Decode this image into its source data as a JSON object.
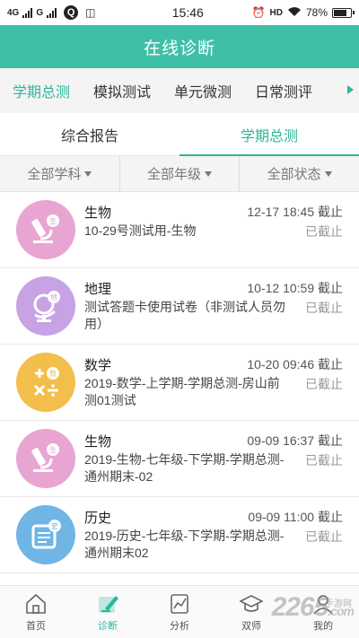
{
  "status_bar": {
    "net_left": "4G",
    "net_mid": "G",
    "time": "15:46",
    "hd": "HD",
    "battery": "78%",
    "battery_level": 0.78
  },
  "header": {
    "title": "在线诊断"
  },
  "category_tabs": [
    {
      "label": "学期总测",
      "active": true
    },
    {
      "label": "模拟测试",
      "active": false
    },
    {
      "label": "单元微测",
      "active": false
    },
    {
      "label": "日常测评",
      "active": false
    }
  ],
  "sub_tabs": [
    {
      "label": "综合报告",
      "active": false
    },
    {
      "label": "学期总测",
      "active": true
    }
  ],
  "filters": [
    {
      "label": "全部学科"
    },
    {
      "label": "全部年级"
    },
    {
      "label": "全部状态"
    }
  ],
  "items": [
    {
      "subject": "生物",
      "title": "10-29号测试用-生物",
      "deadline": "12-17 18:45 截止",
      "status": "已截止",
      "icon": "microscope-icon",
      "color": "#e8a5d2",
      "badge": "生"
    },
    {
      "subject": "地理",
      "title": "测试答题卡使用试卷（非测试人员勿用）",
      "deadline": "10-12 10:59 截止",
      "status": "已截止",
      "icon": "globe-icon",
      "color": "#c7a2e4",
      "badge": "地"
    },
    {
      "subject": "数学",
      "title": "2019-数学-上学期-学期总测-房山前测01测试",
      "deadline": "10-20 09:46 截止",
      "status": "已截止",
      "icon": "math-symbols-icon",
      "color": "#f2be4c",
      "badge": "数"
    },
    {
      "subject": "生物",
      "title": "2019-生物-七年级-下学期-学期总测-通州期末-02",
      "deadline": "09-09 16:37 截止",
      "status": "已截止",
      "icon": "microscope-icon",
      "color": "#e8a5d2",
      "badge": "生"
    },
    {
      "subject": "历史",
      "title": "2019-历史-七年级-下学期-学期总测-通州期末02",
      "deadline": "09-09 11:00 截止",
      "status": "已截止",
      "icon": "scroll-icon",
      "color": "#6fb5e6",
      "badge": "史"
    }
  ],
  "bottom_nav": [
    {
      "label": "首页",
      "icon": "home-icon",
      "active": false
    },
    {
      "label": "诊断",
      "icon": "pencil-icon",
      "active": true
    },
    {
      "label": "分析",
      "icon": "chart-icon",
      "active": false
    },
    {
      "label": "双师",
      "icon": "graduation-cap-icon",
      "active": false
    },
    {
      "label": "我的",
      "icon": "user-icon",
      "active": false
    }
  ],
  "watermark": {
    "text": "2265",
    "suffix": ".com",
    "small": "手游网"
  },
  "colors": {
    "primary": "#3fbfa6",
    "accent": "#2fb59c"
  }
}
